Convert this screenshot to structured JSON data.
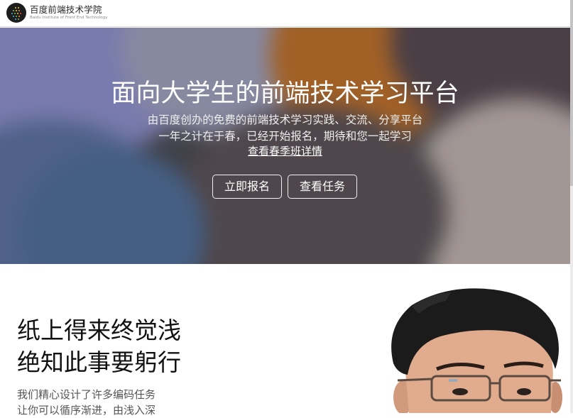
{
  "header": {
    "logo_icon": "baidu-ife-logo",
    "title": "百度前端技术学院",
    "subtitle": "Baidu Institute of Front End Technology"
  },
  "hero": {
    "title": "面向大学生的前端技术学习平台",
    "line1": "由百度创办的免费的前端技术学习实践、交流、分享平台",
    "line2": "一年之计在于春，已经开始报名，期待和您一起学习",
    "link": "查看春季班详情",
    "buttons": {
      "signup": "立即报名",
      "tasks": "查看任务"
    }
  },
  "intro": {
    "slogan_line1": "纸上得来终觉浅",
    "slogan_line2": "绝知此事要躬行",
    "desc_line1": "我们精心设计了许多编码任务",
    "desc_line2": "让你可以循序渐进，由浅入深"
  },
  "colors": {
    "hero_text": "#ffffff",
    "slogan_text": "#111111",
    "desc_text": "#555555"
  }
}
